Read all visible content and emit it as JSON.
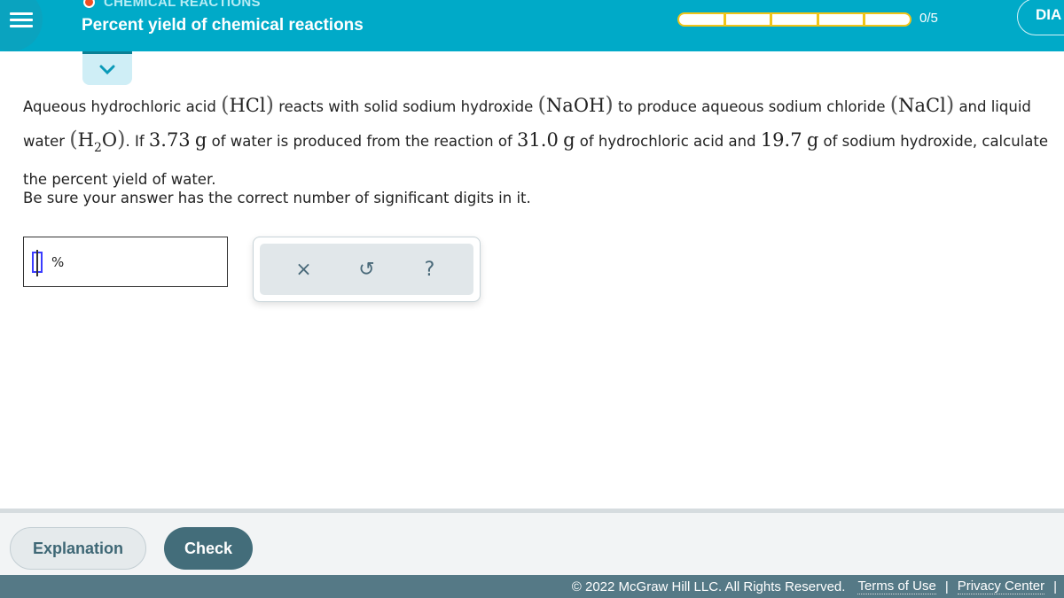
{
  "header": {
    "category": "CHEMICAL REACTIONS",
    "category_dot_color": "#f04e23",
    "title": "Percent yield of chemical reactions",
    "progress": {
      "completed": 0,
      "total": 5,
      "text": "0/5"
    },
    "dia_button": "DIA"
  },
  "question": {
    "p1": "Aqueous hydrochloric acid",
    "hcl": "HCl",
    "p2": "reacts with solid sodium hydroxide",
    "naoh": "NaOH",
    "p3": "to produce aqueous sodium chloride",
    "nacl": "NaCl",
    "p4": "and liquid water",
    "h2o_h": "H",
    "h2o_sub": "2",
    "h2o_o": "O",
    "p5": ". If",
    "water_mass": "3.73",
    "unit_g": "g",
    "p6": "of water is produced from the reaction of",
    "hcl_mass": "31.0",
    "p7": "of hydrochloric acid and",
    "naoh_mass": "19.7",
    "p8": "of sodium hydroxide, calculate the percent yield of water.",
    "note": "Be sure your answer has the correct number of significant digits in it."
  },
  "answer": {
    "value": "",
    "unit": "%"
  },
  "tools": {
    "clear": "×",
    "undo": "↺",
    "help": "?"
  },
  "footer": {
    "explanation": "Explanation",
    "check": "Check",
    "copyright": "© 2022 McGraw Hill LLC. All Rights Reserved.",
    "terms": "Terms of Use",
    "privacy": "Privacy Center",
    "separator": "|"
  }
}
